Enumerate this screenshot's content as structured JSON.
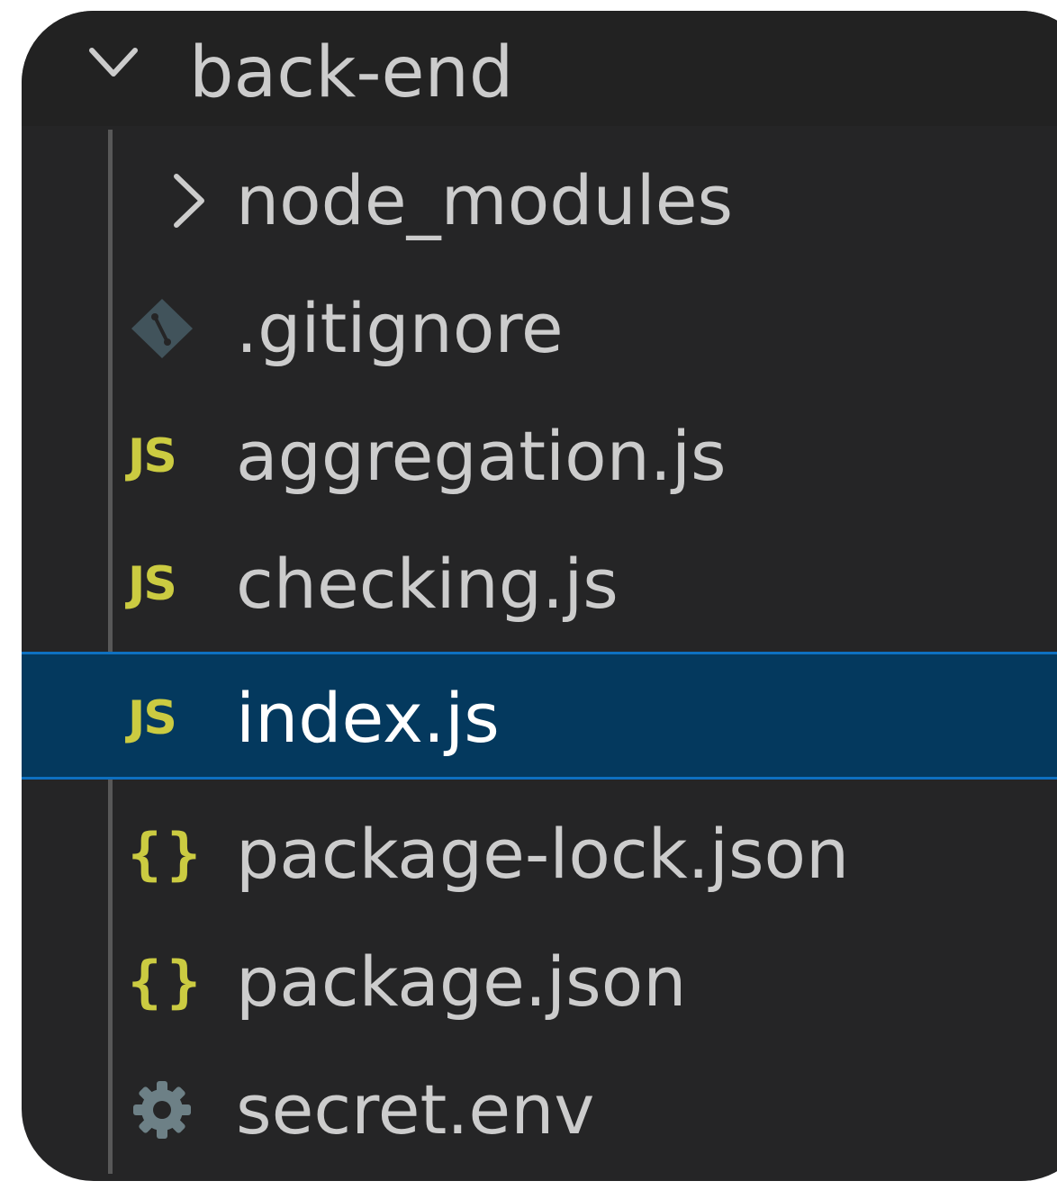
{
  "explorer": {
    "folder": {
      "name": "back-end",
      "expanded": true,
      "chevron_icon": "chevron-down-icon"
    },
    "items": [
      {
        "label": "node_modules",
        "icon": "chevron-right-icon",
        "kind": "folder",
        "selected": false
      },
      {
        "label": ".gitignore",
        "icon": "git-icon",
        "kind": "file",
        "selected": false
      },
      {
        "label": "aggregation.js",
        "icon": "js-icon",
        "icon_text": "JS",
        "kind": "file",
        "selected": false
      },
      {
        "label": "checking.js",
        "icon": "js-icon",
        "icon_text": "JS",
        "kind": "file",
        "selected": false
      },
      {
        "label": "index.js",
        "icon": "js-icon",
        "icon_text": "JS",
        "kind": "file",
        "selected": true
      },
      {
        "label": "package-lock.json",
        "icon": "json-icon",
        "icon_text": "{}",
        "kind": "file",
        "selected": false
      },
      {
        "label": "package.json",
        "icon": "json-icon",
        "icon_text": "{}",
        "kind": "file",
        "selected": false
      },
      {
        "label": "secret.env",
        "icon": "gear-icon",
        "kind": "file",
        "selected": false
      }
    ]
  },
  "colors": {
    "background": "#252526",
    "text": "#cccccc",
    "selection_background": "#04395e",
    "selection_border": "#0e70c0",
    "js_icon": "#cbcb41",
    "json_icon": "#cbcb41",
    "git_icon": "#41535b",
    "gear_icon": "#6d8086"
  }
}
